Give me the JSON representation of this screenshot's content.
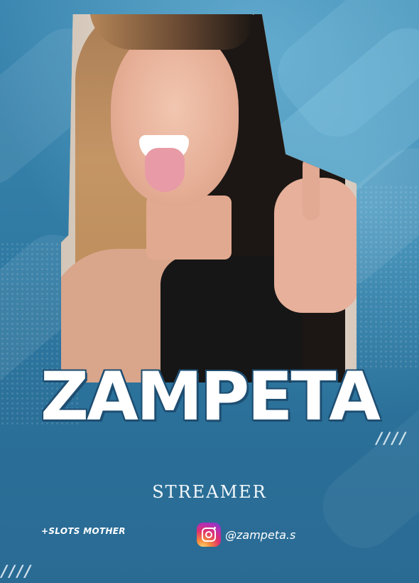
{
  "poster": {
    "name": "ZAMPETA",
    "role": "STREAMER",
    "tagline": "+SLOTS MOTHER",
    "decor_slashes_right": "////",
    "decor_slashes_left": "////"
  },
  "social": {
    "icon": "instagram-icon",
    "handle": "@zampeta.s"
  },
  "colors": {
    "background": "#2c78a0",
    "name_outline": "#1e4e72",
    "text": "#ffffff"
  }
}
